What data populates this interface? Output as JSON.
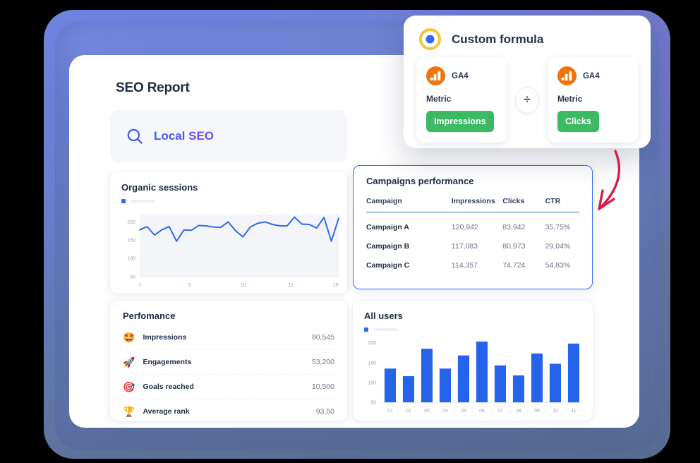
{
  "dashboard": {
    "title": "SEO Report",
    "search": {
      "icon": "search-icon",
      "query": "Local SEO"
    }
  },
  "organic_sessions": {
    "title": "Organic sessions"
  },
  "campaigns": {
    "title": "Campaigns performance",
    "columns": [
      "Campaign",
      "Impressions",
      "Clicks",
      "CTR"
    ],
    "rows": [
      {
        "campaign": "Campaign A",
        "impressions": "120,942",
        "clicks": "83,942",
        "ctr": "35,75%"
      },
      {
        "campaign": "Campaign B",
        "impressions": "117,083",
        "clicks": "80,973",
        "ctr": "29,04%"
      },
      {
        "campaign": "Campaign C",
        "impressions": "114,357",
        "clicks": "74,724",
        "ctr": "54,83%"
      }
    ]
  },
  "performance": {
    "title": "Perfomance",
    "rows": [
      {
        "icon": "star-struck-emoji",
        "glyph": "🤩",
        "label": "Impressions",
        "value": "80,545"
      },
      {
        "icon": "rocket-emoji",
        "glyph": "🚀",
        "label": "Engagements",
        "value": "53,200"
      },
      {
        "icon": "dart-emoji",
        "glyph": "🎯",
        "label": "Goals reached",
        "value": "10,500"
      },
      {
        "icon": "trophy-emoji",
        "glyph": "🏆",
        "label": "Average rank",
        "value": "93,50"
      }
    ]
  },
  "all_users": {
    "title": "All users"
  },
  "popup": {
    "title": "Custom formula",
    "radio_icon": "target-radio-icon",
    "operator": "÷",
    "operator_name": "divide",
    "left": {
      "brand": "GA4",
      "brand_icon": "ga4-bar-chart-icon",
      "field_label": "Metric",
      "value": "Impressions"
    },
    "right": {
      "brand": "GA4",
      "brand_icon": "ga4-bar-chart-icon",
      "field_label": "Metric",
      "value": "Clicks"
    }
  },
  "annotation": {
    "arrow": "red-curved-arrow"
  },
  "colors": {
    "accent_blue": "#3b6ef2",
    "chart_blue": "#2f6bf0",
    "green_pill": "#3bba63",
    "ga4_orange": "#f2720c",
    "arrow_red": "#d81e4a",
    "backdrop_blue": "#6c83cd",
    "text_dark": "#1f2b44"
  },
  "chart_data": [
    {
      "type": "line",
      "title": "Organic sessions",
      "xlabel": "",
      "ylabel": "",
      "ylim": [
        50,
        220
      ],
      "yticks": [
        50,
        100,
        150,
        200
      ],
      "xticks": [
        "1",
        "5",
        "10",
        "11",
        "15"
      ],
      "grid": false,
      "legend": "none",
      "area_fill": true,
      "x": [
        1,
        2,
        3,
        4,
        5,
        6,
        7,
        8,
        9,
        10,
        11,
        12,
        13,
        14,
        15,
        16,
        17,
        18,
        19,
        20,
        21,
        22,
        23,
        24,
        25,
        26,
        27,
        28
      ],
      "values": [
        178,
        187,
        164,
        178,
        187,
        147,
        178,
        177,
        190,
        189,
        186,
        185,
        200,
        176,
        159,
        186,
        196,
        200,
        193,
        189,
        189,
        213,
        194,
        193,
        183,
        212,
        147,
        210
      ]
    },
    {
      "type": "bar",
      "title": "All users",
      "xlabel": "",
      "ylabel": "",
      "ylim": [
        50,
        210
      ],
      "yticks": [
        50,
        100,
        150,
        200
      ],
      "grid": false,
      "legend": "none",
      "categories": [
        "01",
        "02",
        "03",
        "04",
        "05",
        "06",
        "07",
        "08",
        "09",
        "10",
        "11"
      ],
      "values": [
        135,
        116,
        185,
        135,
        168,
        203,
        143,
        118,
        173,
        147,
        198
      ]
    }
  ]
}
